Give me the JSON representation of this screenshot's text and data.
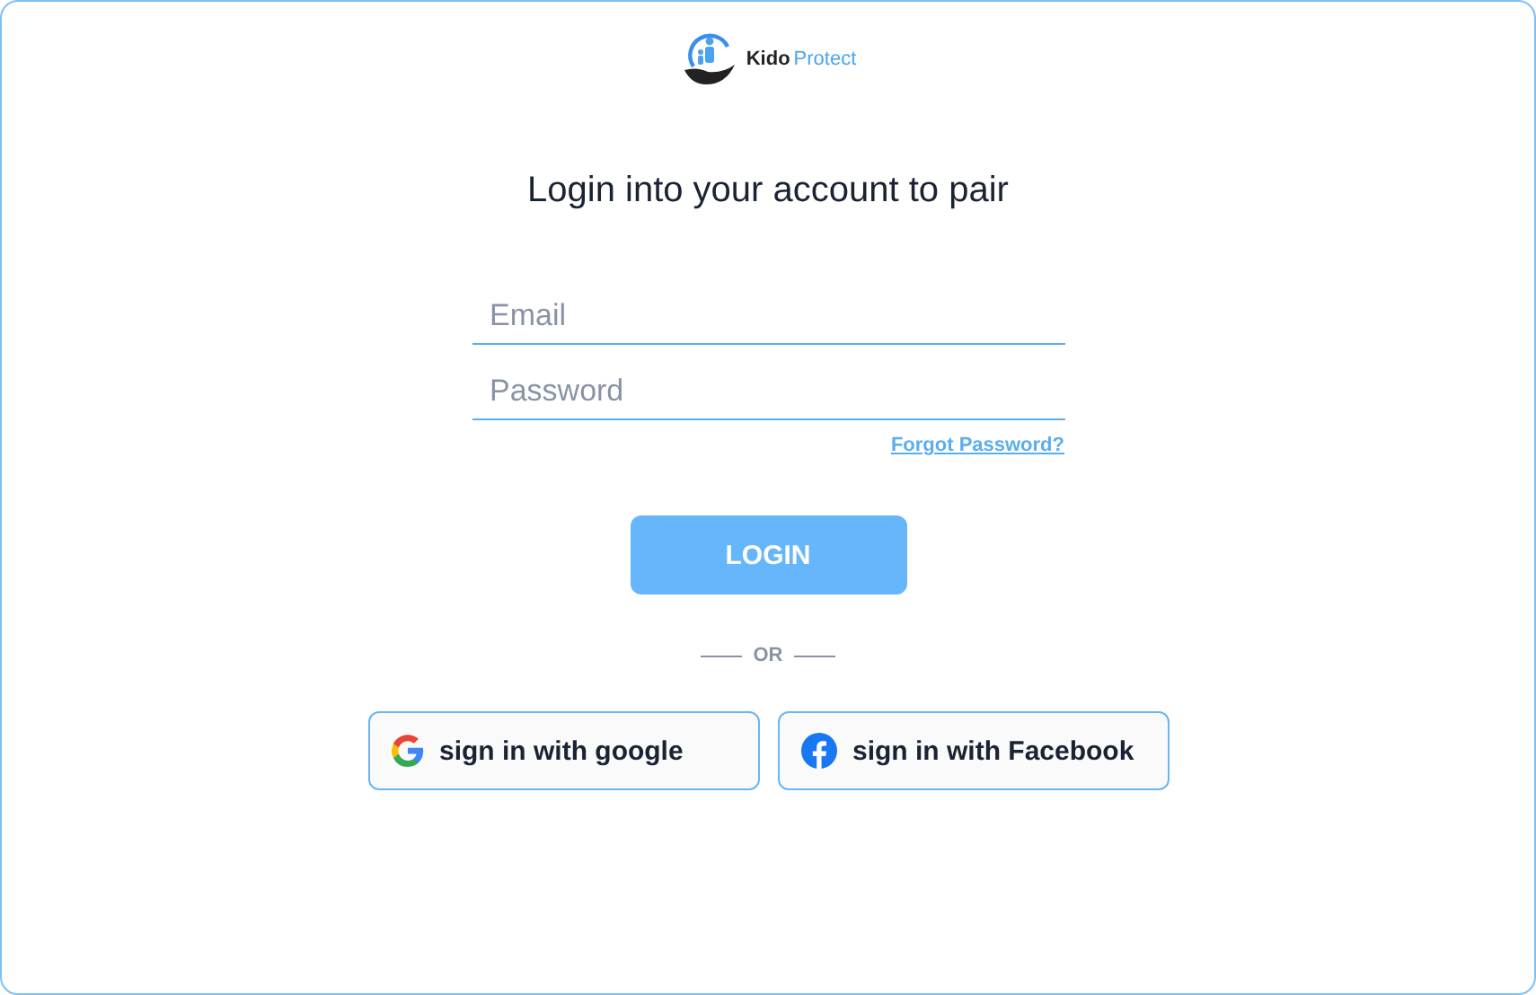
{
  "logo": {
    "name_part_1": "Kido",
    "name_part_2": "Protect"
  },
  "heading": "Login into your account to pair",
  "fields": [
    {
      "placeholder": "Email"
    },
    {
      "placeholder": "Password"
    }
  ],
  "forgot_link": "Forgot Password?",
  "login_button": "LOGIN",
  "divider_text": "OR",
  "social_buttons": [
    {
      "kind": "google",
      "label": "sign in with google"
    },
    {
      "kind": "facebook",
      "label": "sign in with Facebook"
    }
  ]
}
